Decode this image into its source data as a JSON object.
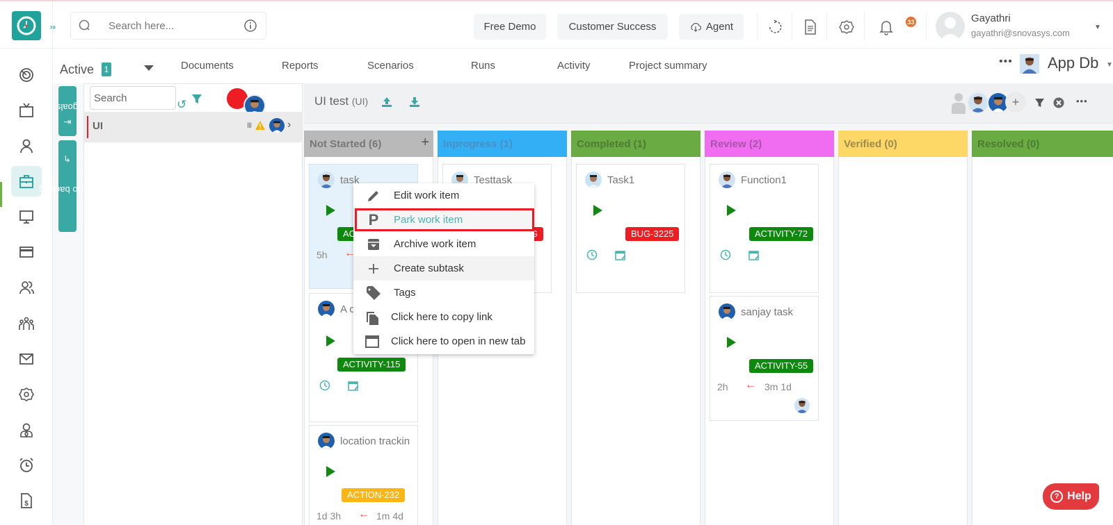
{
  "header": {
    "search_placeholder": "Search here...",
    "buttons": {
      "free_demo": "Free Demo",
      "customer_success": "Customer Success",
      "agent": "Agent"
    },
    "notification_count": "33",
    "user": {
      "name": "Gayathri",
      "email": "gayathri@snovasys.com"
    }
  },
  "leftnav": {
    "items": [
      {
        "icon": "dashboard-icon"
      },
      {
        "icon": "tv-icon"
      },
      {
        "icon": "user-icon"
      },
      {
        "icon": "briefcase-icon",
        "active": true
      },
      {
        "icon": "monitor-icon"
      },
      {
        "icon": "credit-card-icon"
      },
      {
        "icon": "users-icon"
      },
      {
        "icon": "team-icon"
      },
      {
        "icon": "mail-icon"
      },
      {
        "icon": "settings-icon"
      },
      {
        "icon": "employee-icon"
      },
      {
        "icon": "alarm-icon"
      },
      {
        "icon": "invoice-icon"
      }
    ]
  },
  "subnav": {
    "status_filter": "Active",
    "status_count": "1",
    "tabs": [
      "Documents",
      "Reports",
      "Scenarios",
      "Runs",
      "Activity",
      "Project summary"
    ],
    "project_name": "App Db"
  },
  "sidetabs": {
    "goals": "goals",
    "backlog": "Go to backlog"
  },
  "goals": {
    "search_placeholder": "Search",
    "items": [
      {
        "name": "UI"
      }
    ]
  },
  "board": {
    "title": "UI test",
    "title_code": "(UI)",
    "columns": [
      {
        "name": "Not Started (6)",
        "color": "#b9b9b9",
        "text_color": "#777777"
      },
      {
        "name": "Inprogress (1)",
        "color": "#33aff5",
        "text_color": "#4a8fc0"
      },
      {
        "name": "Completed (1)",
        "color": "#6aab43",
        "text_color": "#4c7c33"
      },
      {
        "name": "Review (2)",
        "color": "#f06cf0",
        "text_color": "#a855a8"
      },
      {
        "name": "Verified (0)",
        "color": "#fdd867",
        "text_color": "#9c8a4e"
      },
      {
        "name": "Resolved (0)",
        "color": "#6aab43",
        "text_color": "#4c7c33"
      }
    ],
    "cards": {
      "not_started": [
        {
          "title": "task",
          "tag": "ACTIVITY",
          "tag_color": "#0d8a0d",
          "estimate": "5h"
        },
        {
          "title": "A c",
          "tag": "ACTIVITY-115",
          "tag_color": "#0d8a0d"
        },
        {
          "title": "location trackin",
          "tag": "ACTION-232",
          "tag_color": "#fcb614",
          "estimate": "1d 3h",
          "duration": "1m 4d"
        }
      ],
      "inprogress": [
        {
          "title": "Testtask",
          "tag": "BUG",
          "tag_color": "#ee1d24"
        }
      ],
      "completed": [
        {
          "title": "Task1",
          "tag": "BUG-3225",
          "tag_color": "#ee1d24"
        }
      ],
      "review": [
        {
          "title": "Function1",
          "tag": "ACTIVITY-72",
          "tag_color": "#0d8a0d"
        },
        {
          "title": "sanjay task",
          "tag": "ACTIVITY-55",
          "tag_color": "#0d8a0d",
          "estimate": "2h",
          "duration": "3m 1d"
        }
      ]
    }
  },
  "context_menu": {
    "items": [
      {
        "label": "Edit work item",
        "icon": "pencil-icon"
      },
      {
        "label": "Park work item",
        "icon": "park-icon",
        "highlighted": true
      },
      {
        "label": "Archive work item",
        "icon": "archive-icon"
      },
      {
        "label": "Create subtask",
        "icon": "plus-icon"
      },
      {
        "label": "Tags",
        "icon": "tag-icon"
      },
      {
        "label": "Click here to copy link",
        "icon": "copy-icon"
      },
      {
        "label": "Click here to open in new tab",
        "icon": "new-tab-icon"
      }
    ]
  },
  "help": {
    "label": "Help"
  }
}
